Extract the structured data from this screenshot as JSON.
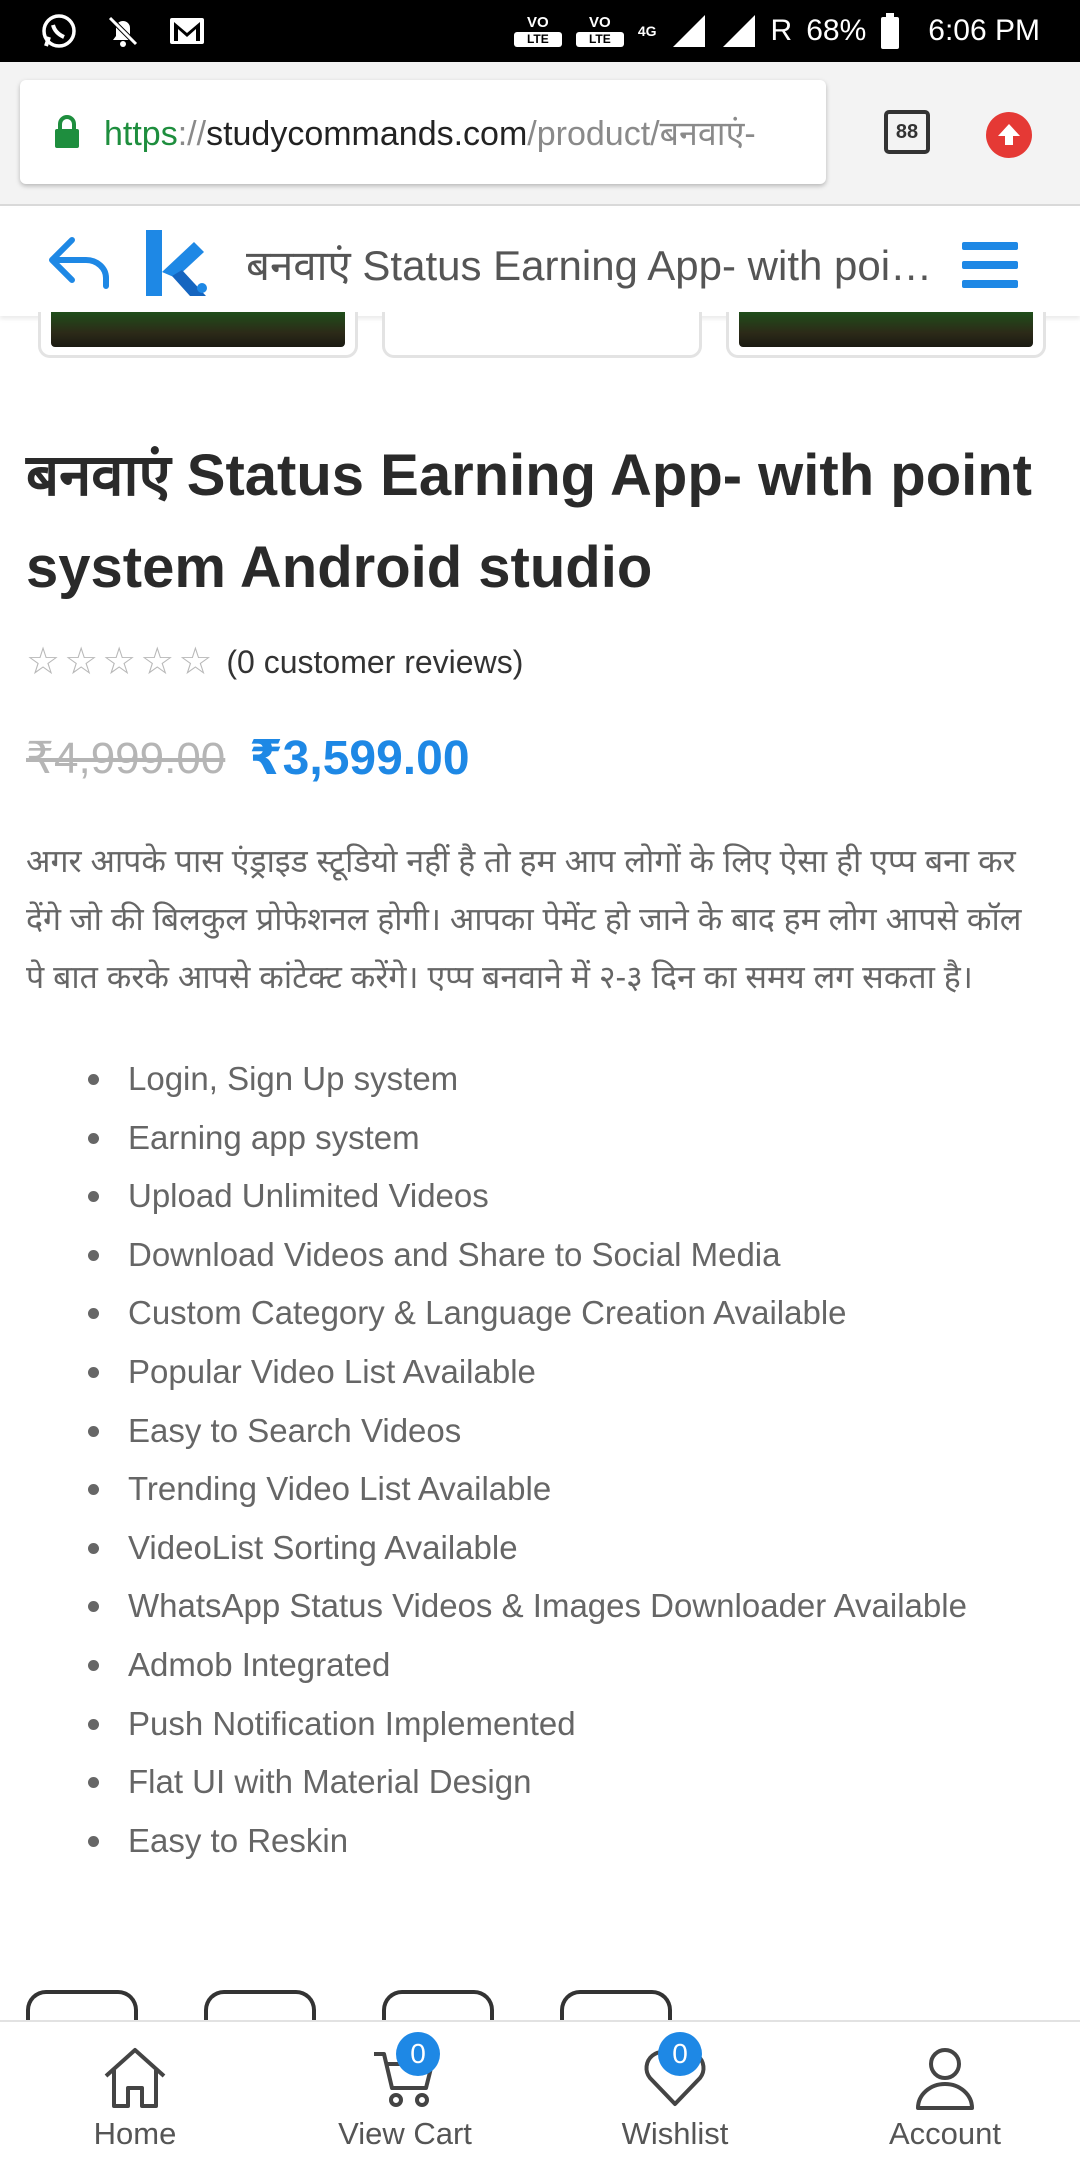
{
  "status_bar": {
    "network1": "VO",
    "network1_sub": "LTE",
    "network2": "VO",
    "network2_sub": "LTE",
    "data_type": "4G",
    "roaming": "R",
    "battery": "68%",
    "time": "6:06 PM"
  },
  "browser": {
    "url_scheme": "https",
    "url_sep": "://",
    "url_domain": "studycommands.com",
    "url_path": "/product/बनवाएं-",
    "tab_count": "88"
  },
  "site_header": {
    "title": "बनवाएं Status Earning App- with point system Android studio"
  },
  "product": {
    "title": "बनवाएं Status Earning App- with point system Android studio",
    "rating": 0,
    "rating_max": 5,
    "reviews_text": "(0 customer reviews)",
    "old_price": "₹4,999.00",
    "new_price": "₹3,599.00",
    "description": "अगर आपके पास एंड्राइड स्टूडियो नहीं है तो हम आप लोगों के लिए ऐसा ही एप्प बना कर देंगे जो की बिलकुल प्रोफेशनल होगी। आपका पेमेंट हो जाने के बाद हम लोग आपसे कॉल पे बात करके आपसे कांटेक्ट करेंगे। एप्प बनवाने में २-३ दिन का समय लग सकता है।",
    "features": [
      "Login, Sign Up system",
      "Earning app system",
      "Upload Unlimited Videos",
      "Download Videos and Share to Social Media",
      "Custom Category & Language Creation Available",
      "Popular Video List Available",
      "Easy to Search Videos",
      "Trending Video List Available",
      "VideoList Sorting Available",
      "WhatsApp Status Videos & Images Downloader Available",
      "Admob Integrated",
      "Push Notification Implemented",
      "Flat UI with Material Design",
      "Easy to Reskin"
    ]
  },
  "bottom_nav": {
    "home": "Home",
    "cart": "View Cart",
    "cart_count": "0",
    "wishlist": "Wishlist",
    "wishlist_count": "0",
    "account": "Account"
  },
  "colors": {
    "accent": "#1e88e5",
    "lock_green": "#1e8e3e",
    "upload_red": "#e53935"
  }
}
